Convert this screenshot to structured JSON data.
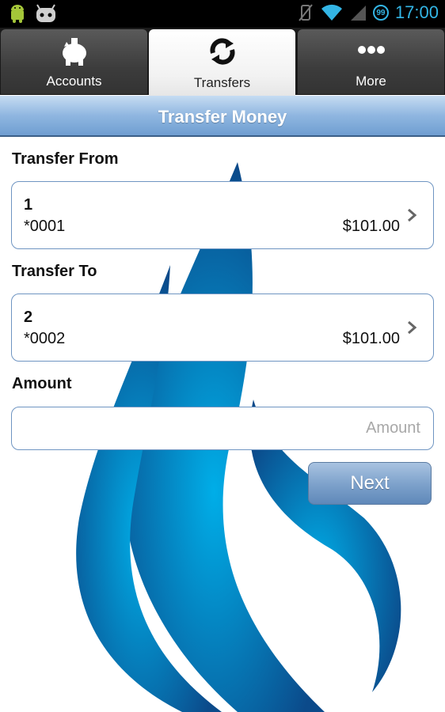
{
  "status_bar": {
    "time": "17:00",
    "badge": "99",
    "icons": [
      "android-icon",
      "cyanogen-icon",
      "mute-icon",
      "wifi-icon",
      "signal-icon"
    ]
  },
  "tabs": [
    {
      "label": "Accounts",
      "icon": "piggy-bank-icon",
      "active": false
    },
    {
      "label": "Transfers",
      "icon": "transfer-arrows-icon",
      "active": true
    },
    {
      "label": "More",
      "icon": "more-dots-icon",
      "active": false
    }
  ],
  "header": {
    "title": "Transfer Money"
  },
  "form": {
    "from_label": "Transfer From",
    "from_account": {
      "name": "1",
      "number": "*0001",
      "balance": "$101.00"
    },
    "to_label": "Transfer To",
    "to_account": {
      "name": "2",
      "number": "*0002",
      "balance": "$101.00"
    },
    "amount_label": "Amount",
    "amount_value": "",
    "amount_placeholder": "Amount",
    "next_label": "Next"
  },
  "colors": {
    "accent": "#33b5e5",
    "border": "#6f95c2",
    "logo_dark": "#0b4a8a",
    "logo_light": "#00aee8"
  }
}
